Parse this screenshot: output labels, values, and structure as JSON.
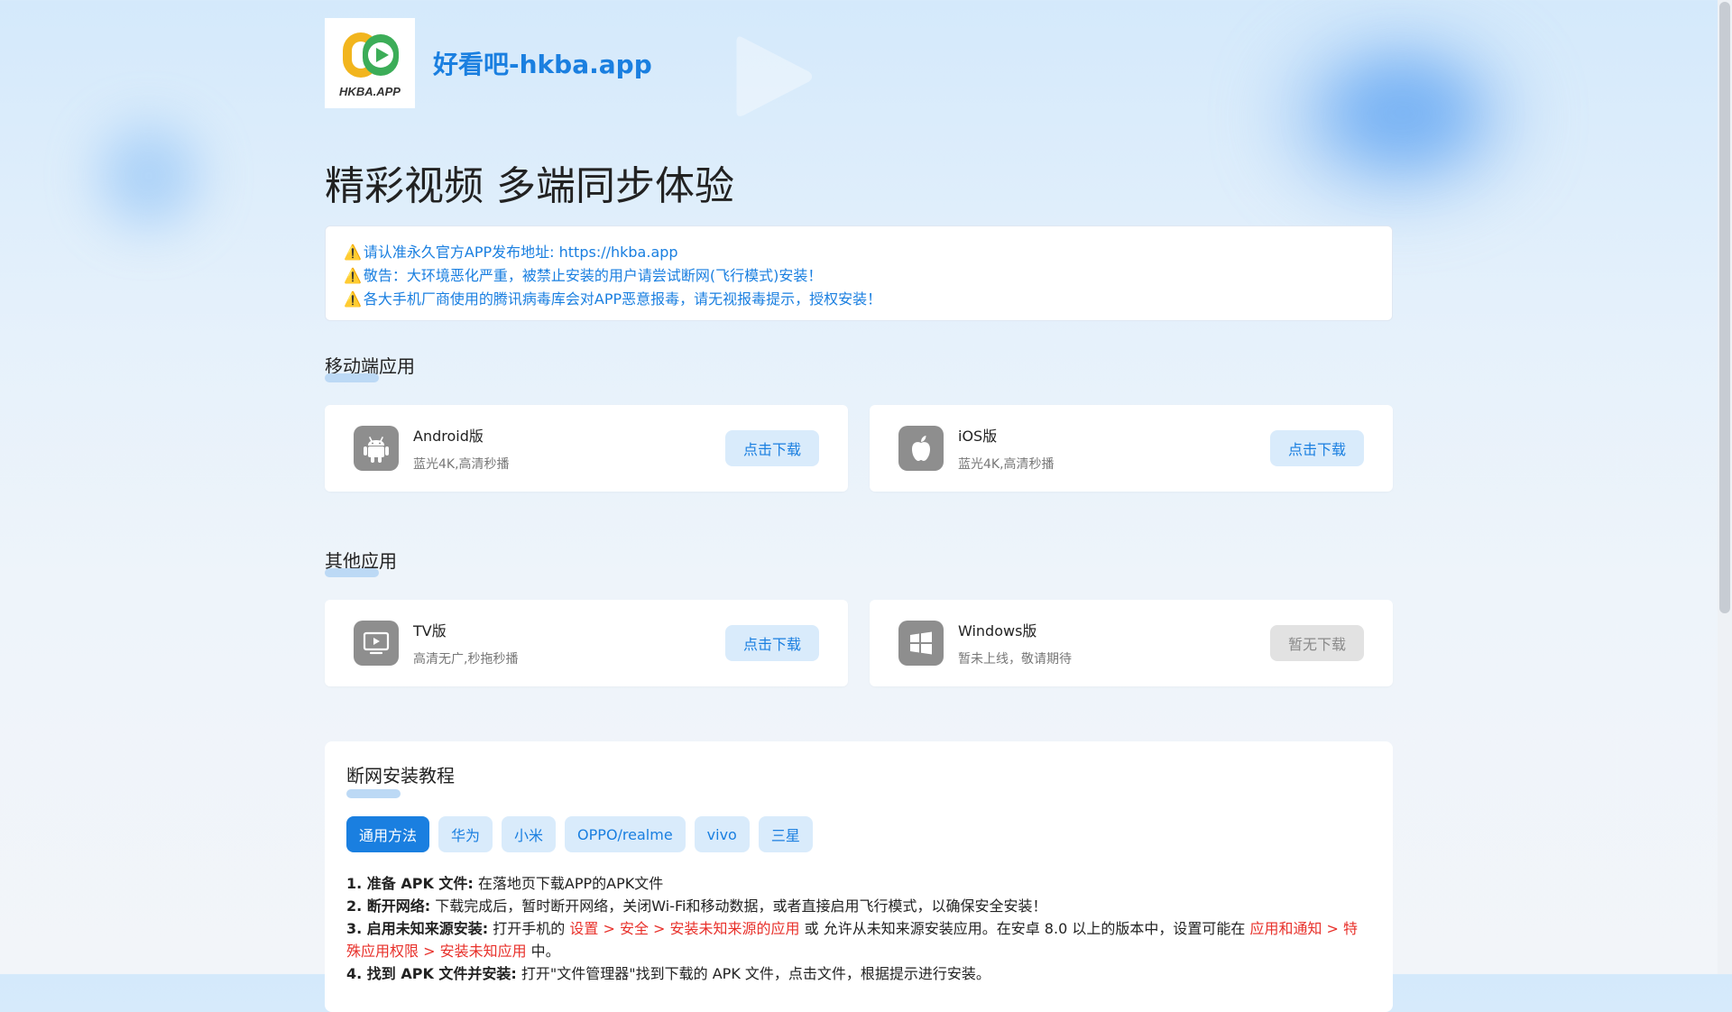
{
  "site": {
    "logo_text": "HKBA.APP",
    "title": "好看吧-hkba.app"
  },
  "headline": "精彩视频 多端同步体验",
  "notices": [
    "请认准永久官方APP发布地址: https://hkba.app",
    "敬告：大环境恶化严重，被禁止安装的用户请尝试断网(飞行模式)安装！",
    "各大手机厂商使用的腾讯病毒库会对APP恶意报毒，请无视报毒提示，授权安装！"
  ],
  "warn_glyph": "⚠️",
  "mobile": {
    "title": "移动端应用",
    "cards": [
      {
        "icon": "android-icon",
        "title": "Android版",
        "sub": "蓝光4K,高清秒播",
        "button": "点击下载"
      },
      {
        "icon": "apple-icon",
        "title": "iOS版",
        "sub": "蓝光4K,高清秒播",
        "button": "点击下载"
      }
    ]
  },
  "other": {
    "title": "其他应用",
    "cards": [
      {
        "icon": "tv-icon",
        "title": "TV版",
        "sub": "高清无广,秒拖秒播",
        "button": "点击下载"
      },
      {
        "icon": "windows-icon",
        "title": "Windows版",
        "sub": "暂未上线，敬请期待",
        "button": "暂无下载"
      }
    ]
  },
  "tutorial": {
    "title": "断网安装教程",
    "tabs": [
      "通用方法",
      "华为",
      "小米",
      "OPPO/realme",
      "vivo",
      "三星"
    ],
    "active_tab": "通用方法",
    "step1_label": "1. 准备 APK 文件:",
    "step1_text": " 在落地页下载APP的APK文件",
    "step2_label": "2. 断开网络:",
    "step2_text": " 下载完成后，暂时断开网络，关闭Wi-Fi和移动数据，或者直接启用飞行模式，以确保安全安装！",
    "step3_label": "3. 启用未知来源安装:",
    "step3_a": " 打开手机的 ",
    "step3_red1": "设置 > 安全 > 安装未知来源的应用",
    "step3_b": " 或 允许从未知来源安装应用。在安卓 8.0 以上的版本中，设置可能在 ",
    "step3_red2": "应用和通知 > 特殊应用权限 > 安装未知应用",
    "step3_c": " 中。",
    "step4_label": "4. 找到 APK 文件并安装:",
    "step4_text": " 打开\"文件管理器\"找到下载的 APK 文件，点击文件，根据提示进行安装。"
  },
  "colors": {
    "accent": "#1a7fe0",
    "warning_red": "#e8302a",
    "icon_gray": "#8e8e8e"
  }
}
